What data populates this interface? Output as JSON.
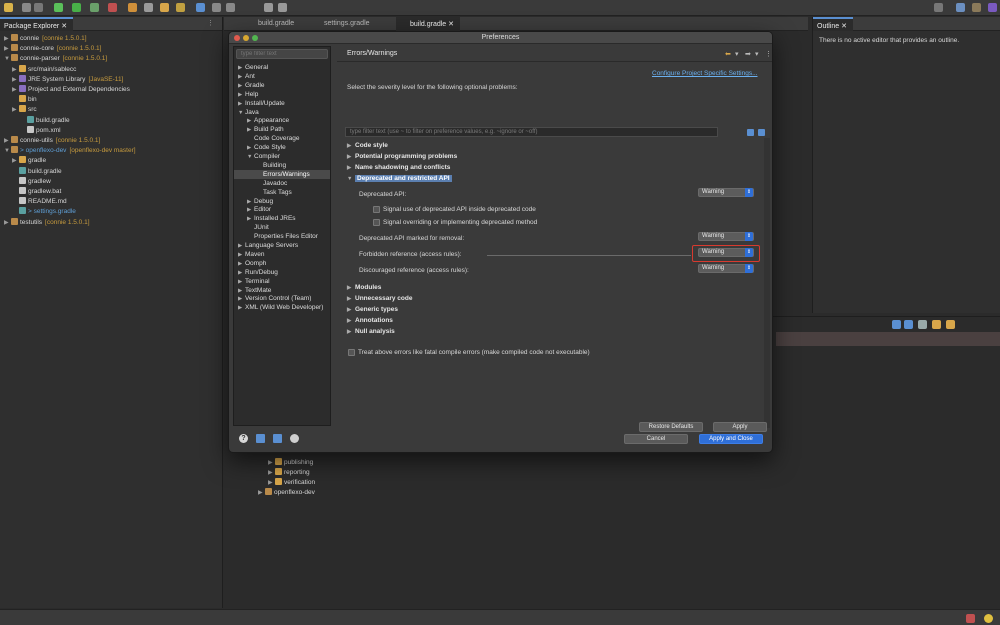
{
  "package_explorer": {
    "tab_label": "Package Explorer",
    "rows": [
      {
        "arrow": "▶",
        "icon": "proj",
        "name": "connie",
        "extra": "[connie 1.5.0.1]",
        "indent": 0
      },
      {
        "arrow": "▶",
        "icon": "proj",
        "name": "connie-core",
        "extra": "[connie 1.5.0.1]",
        "indent": 0
      },
      {
        "arrow": "▼",
        "icon": "proj",
        "name": "connie-parser",
        "extra": "[connie 1.5.0.1]",
        "indent": 0
      },
      {
        "arrow": "▶",
        "icon": "folder",
        "name": "src/main/sablecc",
        "extra": "",
        "indent": 1
      },
      {
        "arrow": "▶",
        "icon": "lib",
        "name": "JRE System Library",
        "extra": "[JavaSE-11]",
        "indent": 1
      },
      {
        "arrow": "▶",
        "icon": "lib",
        "name": "Project and External Dependencies",
        "extra": "",
        "indent": 1
      },
      {
        "arrow": "",
        "icon": "folder",
        "name": "bin",
        "extra": "",
        "indent": 1
      },
      {
        "arrow": "▶",
        "icon": "folder",
        "name": "src",
        "extra": "",
        "indent": 1
      },
      {
        "arrow": "",
        "icon": "gfile",
        "name": "build.gradle",
        "extra": "",
        "indent": 2
      },
      {
        "arrow": "",
        "icon": "file",
        "name": "pom.xml",
        "extra": "",
        "indent": 2
      },
      {
        "arrow": "▶",
        "icon": "proj",
        "name": "connie-utils",
        "extra": "[connie 1.5.0.1]",
        "indent": 0
      },
      {
        "arrow": "▼",
        "icon": "proj",
        "name": "> openflexo-dev",
        "extra": "[openflexo-dev master]",
        "indent": 0
      },
      {
        "arrow": "▶",
        "icon": "folder",
        "name": "gradle",
        "extra": "",
        "indent": 1
      },
      {
        "arrow": "",
        "icon": "gfile",
        "name": "build.gradle",
        "extra": "",
        "indent": 1
      },
      {
        "arrow": "",
        "icon": "file",
        "name": "gradlew",
        "extra": "",
        "indent": 1
      },
      {
        "arrow": "",
        "icon": "file",
        "name": "gradlew.bat",
        "extra": "",
        "indent": 1
      },
      {
        "arrow": "",
        "icon": "file",
        "name": "README.md",
        "extra": "",
        "indent": 1
      },
      {
        "arrow": "",
        "icon": "gfile",
        "name": "> settings.gradle",
        "extra": "",
        "indent": 1
      },
      {
        "arrow": "▶",
        "icon": "proj",
        "name": "testutils",
        "extra": "[connie 1.5.0.1]",
        "indent": 0
      }
    ]
  },
  "editor_tabs": [
    "build.gradle",
    "settings.gradle",
    "build.gradle"
  ],
  "outline": {
    "tab_label": "Outline",
    "message": "There is no active editor that provides an outline."
  },
  "lower_tree": [
    {
      "name": "publishing"
    },
    {
      "name": "reporting"
    },
    {
      "name": "verification"
    },
    {
      "name": "openflexo-dev"
    }
  ],
  "dialog": {
    "title": "Preferences",
    "filter_placeholder": "type filter text",
    "nav": [
      {
        "label": "General",
        "arrow": "▶",
        "indent": 0
      },
      {
        "label": "Ant",
        "arrow": "▶",
        "indent": 0
      },
      {
        "label": "Gradle",
        "arrow": "▶",
        "indent": 0
      },
      {
        "label": "Help",
        "arrow": "▶",
        "indent": 0
      },
      {
        "label": "Install/Update",
        "arrow": "▶",
        "indent": 0
      },
      {
        "label": "Java",
        "arrow": "▼",
        "indent": 0
      },
      {
        "label": "Appearance",
        "arrow": "▶",
        "indent": 1
      },
      {
        "label": "Build Path",
        "arrow": "▶",
        "indent": 1
      },
      {
        "label": "Code Coverage",
        "arrow": "",
        "indent": 1
      },
      {
        "label": "Code Style",
        "arrow": "▶",
        "indent": 1
      },
      {
        "label": "Compiler",
        "arrow": "▼",
        "indent": 1
      },
      {
        "label": "Building",
        "arrow": "",
        "indent": 2
      },
      {
        "label": "Errors/Warnings",
        "arrow": "",
        "indent": 2,
        "selected": true
      },
      {
        "label": "Javadoc",
        "arrow": "",
        "indent": 2
      },
      {
        "label": "Task Tags",
        "arrow": "",
        "indent": 2
      },
      {
        "label": "Debug",
        "arrow": "▶",
        "indent": 1
      },
      {
        "label": "Editor",
        "arrow": "▶",
        "indent": 1
      },
      {
        "label": "Installed JREs",
        "arrow": "▶",
        "indent": 1
      },
      {
        "label": "JUnit",
        "arrow": "",
        "indent": 1
      },
      {
        "label": "Properties Files Editor",
        "arrow": "",
        "indent": 1
      },
      {
        "label": "Language Servers",
        "arrow": "▶",
        "indent": 0
      },
      {
        "label": "Maven",
        "arrow": "▶",
        "indent": 0
      },
      {
        "label": "Oomph",
        "arrow": "▶",
        "indent": 0
      },
      {
        "label": "Run/Debug",
        "arrow": "▶",
        "indent": 0
      },
      {
        "label": "Terminal",
        "arrow": "▶",
        "indent": 0
      },
      {
        "label": "TextMate",
        "arrow": "▶",
        "indent": 0
      },
      {
        "label": "Version Control (Team)",
        "arrow": "▶",
        "indent": 0
      },
      {
        "label": "XML (Wild Web Developer)",
        "arrow": "▶",
        "indent": 0
      }
    ],
    "page_title": "Errors/Warnings",
    "configure_link": "Configure Project Specific Settings...",
    "severity_intro": "Select the severity level for the following optional problems:",
    "search_placeholder": "type filter text (use ~ to filter on preference values, e.g. ~ignore or ~off)",
    "sections_top": [
      "Code style",
      "Potential programming problems",
      "Name shadowing and conflicts"
    ],
    "open_section": "Deprecated and restricted API",
    "deprecated_api_label": "Deprecated API:",
    "deprecated_api_value": "Warning",
    "cb1_label": "Signal use of deprecated API inside deprecated code",
    "cb2_label": "Signal overriding or implementing deprecated method",
    "for_removal_label": "Deprecated API marked for removal:",
    "for_removal_value": "Warning",
    "forbidden_label": "Forbidden reference (access rules):",
    "forbidden_value": "Warning",
    "discouraged_label": "Discouraged reference (access rules):",
    "discouraged_value": "Warning",
    "sections_bottom": [
      "Modules",
      "Unnecessary code",
      "Generic types",
      "Annotations",
      "Null analysis"
    ],
    "treat_errors_label": "Treat above errors like fatal compile errors (make compiled code not executable)",
    "restore_label": "Restore Defaults",
    "apply_label": "Apply",
    "cancel_label": "Cancel",
    "apply_close_label": "Apply and Close"
  },
  "colors": {
    "accent": "#2f6fd8",
    "highlight": "#d83a2f",
    "link": "#6ab0f0"
  }
}
